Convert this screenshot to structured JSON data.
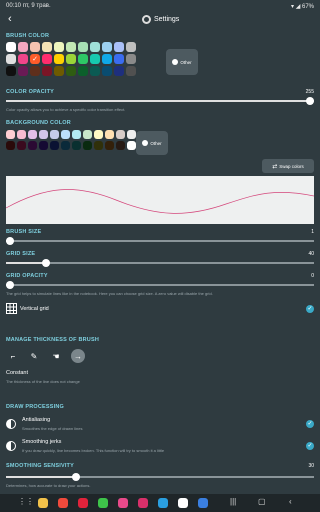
{
  "status": {
    "time": "00:10",
    "date": "пт, 9 трав.",
    "battery": "67%"
  },
  "header": {
    "title": "Settings",
    "back_icon": "arrow-back-icon",
    "settings_icon": "gear-icon"
  },
  "brush_color": {
    "label": "BRUSH COLOR",
    "other_label": "Other",
    "selected_index": 13,
    "swatches": [
      "#ffffff",
      "#f3a8c0",
      "#f6c3b0",
      "#f3e3b6",
      "#eef5bd",
      "#c2e8b4",
      "#a7dfb4",
      "#9fe0d8",
      "#9cd0f0",
      "#aac0f8",
      "#bfbfbf",
      "#e0e0e0",
      "#f0458a",
      "#ff5c2a",
      "#ff2d6e",
      "#ffd000",
      "#9bd438",
      "#2ec866",
      "#17c9b0",
      "#10a8e8",
      "#3b6cf0",
      "#8a8a8a",
      "#101010",
      "#6a1a55",
      "#5e2f1c",
      "#7a1526",
      "#6e5a00",
      "#2f5c12",
      "#0c5f2b",
      "#0b5a53",
      "#0a4c70",
      "#1e2f7e",
      "#505050"
    ]
  },
  "color_opacity": {
    "label": "COLOR OPACITY",
    "value": "255",
    "fraction": 1.0,
    "description": "Color opacity allows you to achieve a specific color transition effect."
  },
  "background_color": {
    "label": "BACKGROUND COLOR",
    "other_label": "Other",
    "swatches": [
      "#ffcdd2",
      "#f8bbd0",
      "#e1bee7",
      "#d1c4e9",
      "#c5cae9",
      "#bbdefb",
      "#b2ebf2",
      "#c8e6c9",
      "#fff9c4",
      "#ffe0b2",
      "#d7ccc8",
      "#eeeeee",
      "#2a0a0a",
      "#3a0a1e",
      "#2b0a33",
      "#150a33",
      "#0a1233",
      "#0a2a3a",
      "#0a3030",
      "#0a2a10",
      "#30300a",
      "#33200a",
      "#261a14",
      "#ffffff"
    ]
  },
  "swap_colors": {
    "label": "Swap colors",
    "icon": "swap-icon"
  },
  "brush_size": {
    "label": "BRUSH SIZE",
    "value": "1",
    "fraction": 0.0
  },
  "grid_size": {
    "label": "GRID SIZE",
    "value": "40",
    "fraction": 0.12
  },
  "grid_opacity": {
    "label": "GRID OPACITY",
    "value": "0",
    "fraction": 0.0,
    "description": "The grid helps to simulate lines like in the notebook. Here you can choose grid size. A zero value will disable the grid."
  },
  "vertical_grid": {
    "label": "Vertical grid",
    "checked": true,
    "icon": "grid-icon"
  },
  "thickness": {
    "label": "MANAGE THICKNESS OF BRUSH",
    "options": [
      {
        "icon": "corner-thickness-icon",
        "active": false
      },
      {
        "icon": "pen-thickness-icon",
        "active": false
      },
      {
        "icon": "touch-thickness-icon",
        "active": false
      },
      {
        "icon": "arrow-constant-icon",
        "active": true
      }
    ],
    "mode_title": "Constant",
    "mode_description": "The thickness of the line does not change"
  },
  "draw_processing": {
    "label": "DRAW PROCESSING",
    "antialiasing": {
      "title": "Antialiasing",
      "description": "Smoothes the edge of drawn lines",
      "checked": true
    },
    "smoothing_jerks": {
      "title": "Smoothing jerks",
      "description": "If you draw quickly, line becomes broken. This function will try to smooth it a little",
      "checked": true
    }
  },
  "smoothing_sensivity": {
    "label": "SMOOTHING SENSIVITY",
    "value": "30",
    "fraction": 0.22,
    "description": "Determines, how accurate to draw your actions."
  },
  "navbar": {
    "apps": [
      "#f2c24a",
      "#f04a3c",
      "#e0233b",
      "#3ec44a",
      "#e84a8a",
      "#d8306a",
      "#2a9fe0",
      "#ffffff",
      "#3a7fe0"
    ]
  }
}
